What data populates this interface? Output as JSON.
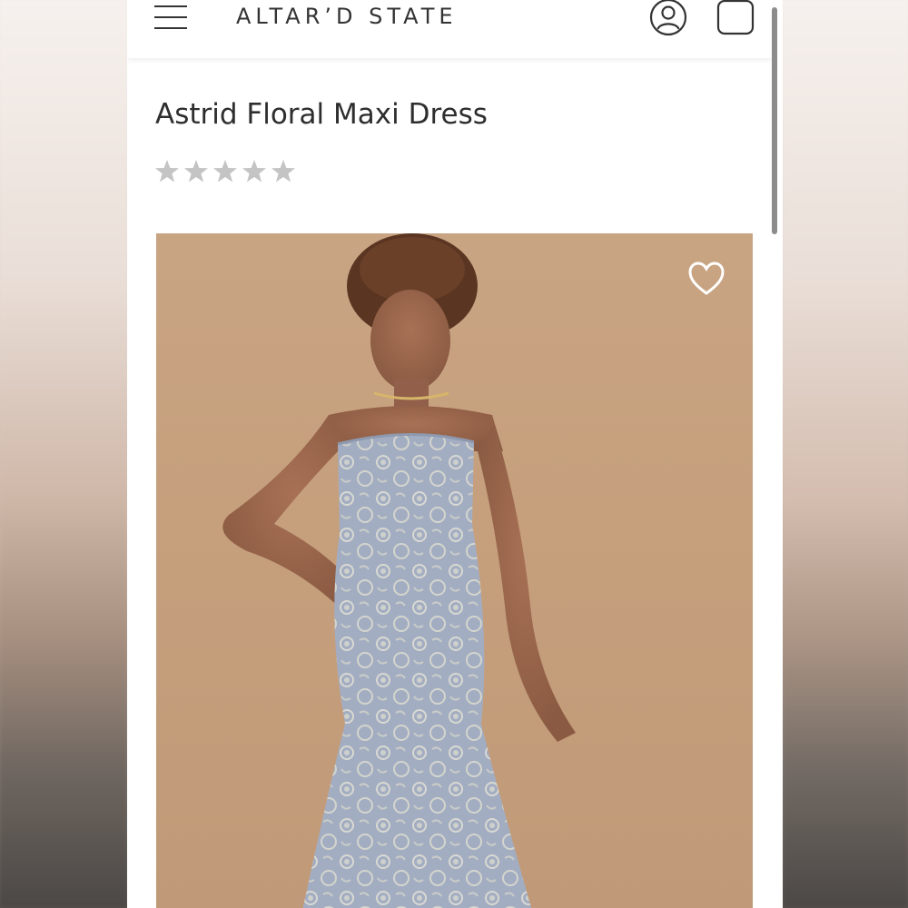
{
  "header": {
    "brand": "ALTAR’D STATE",
    "menu_icon": "hamburger-menu-icon",
    "account_icon": "account-icon",
    "cart_icon": "shopping-bag-icon"
  },
  "product": {
    "title": "Astrid Floral Maxi Dress",
    "rating": {
      "stars_filled": 0,
      "stars_total": 5
    },
    "favorite_icon": "heart-outline-icon"
  },
  "colors": {
    "header_text": "#333333",
    "title_text": "#2e2e2e",
    "star_empty": "#c4c4c4",
    "photo_backdrop": "#c6a07d",
    "dress": "#a3adc2"
  }
}
